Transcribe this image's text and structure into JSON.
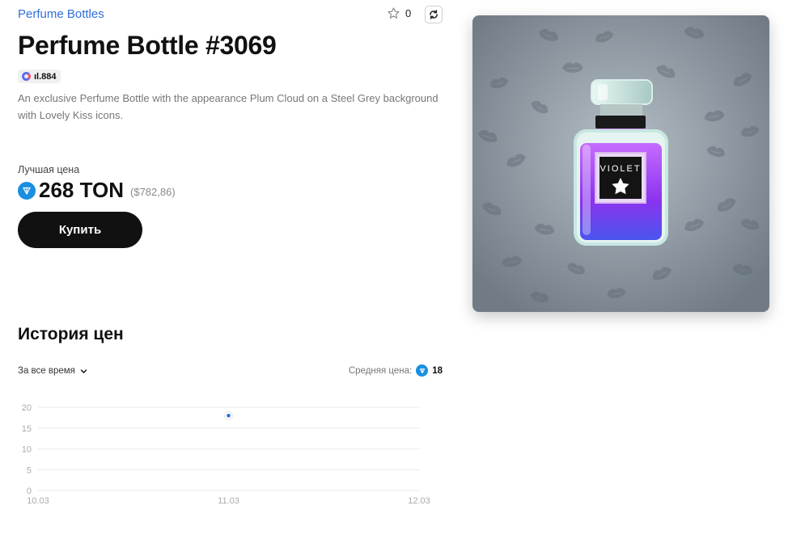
{
  "header": {
    "collection": "Perfume Bottles",
    "favorites_count": "0"
  },
  "item": {
    "title": "Perfume Bottle #3069",
    "badge": "ıl.884",
    "description": "An exclusive Perfume Bottle with the appearance Plum Cloud on a Steel Grey background with Lovely Kiss icons.",
    "label_text": "VIOLET"
  },
  "price": {
    "label": "Лучшая цена",
    "value": "268 TON",
    "usd": "($782,86)",
    "buy_label": "Купить"
  },
  "history": {
    "title": "История цен",
    "period": "За все время",
    "avg_label": "Средняя цена:",
    "avg_value": "18"
  },
  "colors": {
    "accent": "#2f6fdb",
    "ton": "#1a8fe0",
    "button": "#111111",
    "card_bg": "#7b8690",
    "bottle_liquid": "#8b3cf0"
  },
  "chart_data": {
    "type": "scatter",
    "x_ticks": [
      "10.03",
      "11.03",
      "12.03"
    ],
    "y_ticks": [
      0,
      5,
      10,
      15,
      20
    ],
    "ylim": [
      0,
      20
    ],
    "points": [
      {
        "x": "11.03",
        "y": 18
      }
    ],
    "grid": true
  }
}
